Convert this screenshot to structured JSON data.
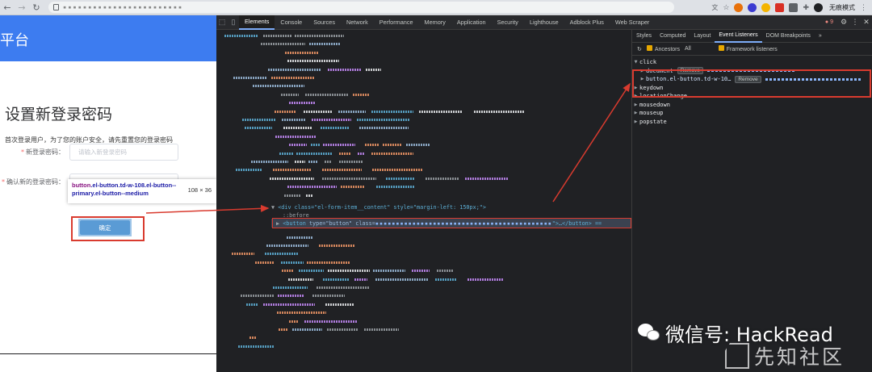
{
  "browser": {
    "back_icon": "back-arrow-icon",
    "forward_icon": "forward-arrow-icon",
    "reload_icon": "reload-icon",
    "profile_label": "无痕模式"
  },
  "app": {
    "header_title": "平台",
    "page_title": "设置新登录密码",
    "description": "首次登录用户，为了您的账户安全，请先重置您的登录密码",
    "new_password_label": "新登录密码：",
    "new_password_placeholder": "请输入新登录密码",
    "confirm_password_label": "确认新的登录密码：",
    "confirm_button": "确定"
  },
  "tooltip": {
    "selector_tag": "button",
    "selector_rest": ".el-button.td-w-108.el-button--primary.el-button--medium",
    "size": "108 × 36"
  },
  "devtools": {
    "tabs": [
      "Elements",
      "Console",
      "Sources",
      "Network",
      "Performance",
      "Memory",
      "Application",
      "Security",
      "Lighthouse",
      "Adblock Plus",
      "Web Scraper"
    ],
    "active_tab": "Elements",
    "error_count": "9",
    "code_div": "<div class=\"el-form-item__content\" style=\"margin-left: 150px;\">",
    "code_before": "::before",
    "code_button_tag": "<button",
    "code_button_type": "type=\"button\"",
    "code_button_class": "class=",
    "code_button_end": "\">…</button> ==",
    "side_tabs": [
      "Styles",
      "Computed",
      "Layout",
      "Event Listeners",
      "DOM Breakpoints"
    ],
    "active_side_tab": "Event Listeners",
    "ancestors_label": "Ancestors",
    "all_label": "All",
    "framework_label": "Framework listeners",
    "events": {
      "click": "click",
      "click_document": "document",
      "click_button": "button.el-button.td-w-10…",
      "remove": "Remove",
      "keydown": "keydown",
      "location_change": "locationChange",
      "mousedown": "mousedown",
      "mouseup": "mouseup",
      "popstate": "popstate"
    }
  },
  "watermark": {
    "wechat": "微信号: HackRead",
    "site": "先知社区"
  },
  "colors": {
    "accent_blue": "#3d7cf0",
    "highlight_red": "#d93b2f",
    "devtools_bg": "#202124"
  }
}
